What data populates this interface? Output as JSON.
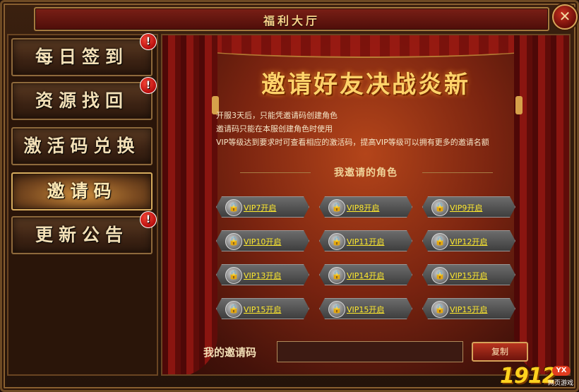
{
  "window": {
    "title": "福利大厅"
  },
  "colors": {
    "accent": "#ffd36a",
    "stage_red": "#7a2410",
    "slot_label": "#ffea2e"
  },
  "sidebar": {
    "items": [
      {
        "label": "每日签到",
        "badge": "!",
        "active": false
      },
      {
        "label": "资源找回",
        "badge": "!",
        "active": false
      },
      {
        "label": "激活码兑换",
        "badge": "",
        "active": false
      },
      {
        "label": "邀请码",
        "badge": "",
        "active": true
      },
      {
        "label": "更新公告",
        "badge": "!",
        "active": false
      }
    ]
  },
  "main": {
    "banner": "邀请好友决战炎新",
    "notices": [
      "开服3天后，只能凭邀请码创建角色",
      "邀请码只能在本服创建角色时使用",
      "VIP等级达到要求时可查看相应的激活码，提高VIP等级可以拥有更多的邀请名额"
    ],
    "section_title": "我邀请的角色",
    "slots": [
      "VIP7开启",
      "VIP8开启",
      "VIP9开启",
      "VIP10开启",
      "VIP11开启",
      "VIP12开启",
      "VIP13开启",
      "VIP14开启",
      "VIP15开启",
      "VIP15开启",
      "VIP15开启",
      "VIP15开启"
    ],
    "code_label": "我的邀请码",
    "code_value": "",
    "copy_label": "复制"
  },
  "watermark": {
    "number": "1912",
    "badge": "YX",
    "sub": "网页游戏"
  }
}
